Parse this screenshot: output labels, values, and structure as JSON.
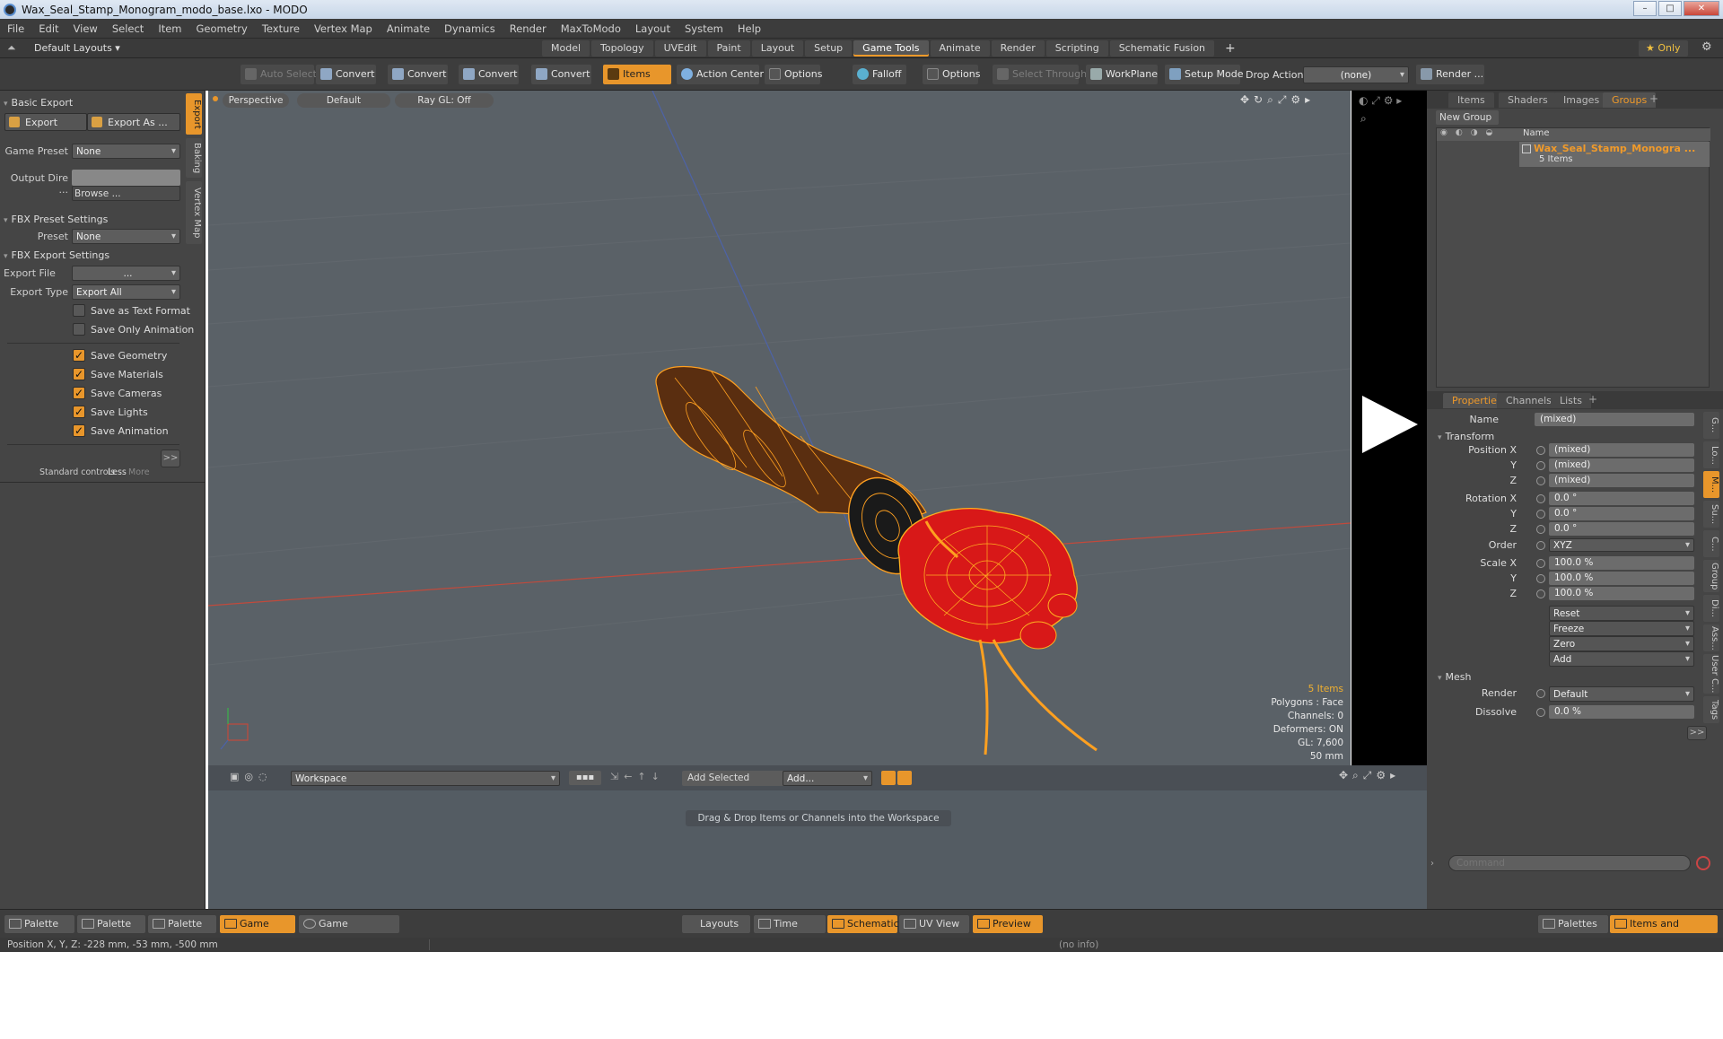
{
  "window": {
    "title": "Wax_Seal_Stamp_Monogram_modo_base.lxo - MODO",
    "min": "–",
    "max": "□",
    "close": "✕"
  },
  "menu": [
    "File",
    "Edit",
    "View",
    "Select",
    "Item",
    "Geometry",
    "Texture",
    "Vertex Map",
    "Animate",
    "Dynamics",
    "Render",
    "MaxToModo",
    "Layout",
    "System",
    "Help"
  ],
  "layout_selector": "Default Layouts ▾",
  "workspace_tabs": [
    {
      "label": "Model",
      "active": false
    },
    {
      "label": "Topology",
      "active": false
    },
    {
      "label": "UVEdit",
      "active": false
    },
    {
      "label": "Paint",
      "active": false
    },
    {
      "label": "Layout",
      "active": false
    },
    {
      "label": "Setup",
      "active": false
    },
    {
      "label": "Game Tools",
      "active": true
    },
    {
      "label": "Animate",
      "active": false
    },
    {
      "label": "Render",
      "active": false
    },
    {
      "label": "Scripting",
      "active": false
    },
    {
      "label": "Schematic Fusion",
      "active": false
    }
  ],
  "add_tab": "+",
  "only_label": "★ Only",
  "toolbar": {
    "auto_select": "Auto Select",
    "convert1": "Convert",
    "convert2": "Convert",
    "convert3": "Convert",
    "convert4": "Convert",
    "items": "Items",
    "action_center": "Action Center",
    "options1": "Options",
    "falloff": "Falloff",
    "options2": "Options",
    "select_through": "Select Through",
    "workplane": "WorkPlane",
    "setup_mode": "Setup Mode",
    "drop_action": "Drop Action",
    "drop_value": "(none)",
    "render": "Render ..."
  },
  "left": {
    "basic_export": "Basic Export",
    "export": "Export",
    "export_as": "Export As ...",
    "game_preset_label": "Game Preset",
    "game_preset_value": "None",
    "output_dir_label": "Output Dire ...",
    "output_dir_value": "",
    "browse": "Browse ...",
    "fbx_preset_settings": "FBX Preset Settings",
    "preset_label": "Preset",
    "preset_value": "None",
    "fbx_export_settings": "FBX Export Settings",
    "export_file_label": "Export File",
    "export_file_value": "...",
    "export_type_label": "Export Type",
    "export_type_value": "Export All",
    "checks": [
      {
        "label": "Save as Text Format",
        "checked": false
      },
      {
        "label": "Save Only Animation",
        "checked": false
      },
      {
        "label": "Save Geometry",
        "checked": true
      },
      {
        "label": "Save Materials",
        "checked": true
      },
      {
        "label": "Save Cameras",
        "checked": true
      },
      {
        "label": "Save Lights",
        "checked": true
      },
      {
        "label": "Save Animation",
        "checked": true
      }
    ],
    "expand": ">>",
    "standard_controls": "Standard controls",
    "less": "Less",
    "more": "More",
    "vtabs": [
      "Export",
      "Baking",
      "Vertex Map"
    ]
  },
  "viewport": {
    "perspective": "Perspective",
    "default": "Default",
    "raygl": "Ray GL: Off",
    "info": {
      "items": "5 Items",
      "polygons": "Polygons : Face",
      "channels": "Channels: 0",
      "deformers": "Deformers: ON",
      "gl": "GL: 7,600",
      "scale": "50 mm"
    }
  },
  "schematic": {
    "workspace": "Workspace",
    "add_selected": "Add Selected",
    "add": "Add...",
    "hint": "Drag & Drop Items or Channels into the Workspace"
  },
  "right": {
    "tabs": [
      {
        "label": "Items",
        "active": false
      },
      {
        "label": "Shaders",
        "active": false
      },
      {
        "label": "Images",
        "active": false
      },
      {
        "label": "Groups",
        "active": true
      }
    ],
    "new_group": "New Group",
    "name_header": "Name",
    "group_name": "Wax_Seal_Stamp_Monogra ...",
    "group_count": "5 Items",
    "prop_tabs": [
      {
        "label": "Properties",
        "active": true
      },
      {
        "label": "Channels",
        "active": false
      },
      {
        "label": "Lists",
        "active": false
      }
    ],
    "name_label": "Name",
    "name_value": "(mixed)",
    "transform": "Transform",
    "position_label": "Position X",
    "pos": [
      "(mixed)",
      "(mixed)",
      "(mixed)"
    ],
    "rotation_label": "Rotation X",
    "rot": [
      "0.0 °",
      "0.0 °",
      "0.0 °"
    ],
    "order_label": "Order",
    "order_value": "XYZ",
    "scale_label": "Scale X",
    "scale": [
      "100.0 %",
      "100.0 %",
      "100.0 %"
    ],
    "y": "Y",
    "z": "Z",
    "actions": [
      "Reset",
      "Freeze",
      "Zero",
      "Add"
    ],
    "mesh": "Mesh",
    "render_label": "Render",
    "render_value": "Default",
    "dissolve_label": "Dissolve",
    "dissolve_value": "0.0 %",
    "side_tabs": [
      "G...",
      "Lo...",
      "M...",
      "Su...",
      "C...",
      "Group",
      "Di...",
      "Ass...",
      "User C...",
      "Tags"
    ],
    "command_placeholder": "Command"
  },
  "footer": {
    "left": [
      {
        "label": "Palette",
        "active": false
      },
      {
        "label": "Palette",
        "active": false
      },
      {
        "label": "Palette",
        "active": false
      },
      {
        "label": "Game Tools",
        "active": true
      },
      {
        "label": "Game Navigation",
        "active": false
      }
    ],
    "center": [
      {
        "label": "Layouts",
        "active": false
      },
      {
        "label": "Time",
        "active": false
      },
      {
        "label": "Schematic",
        "active": true
      },
      {
        "label": "UV View",
        "active": false
      },
      {
        "label": "Preview",
        "active": true
      }
    ],
    "palettes": "Palettes",
    "items_shading": "Items and Shading"
  },
  "status": {
    "position": "Position X, Y, Z:   -228 mm, -53 mm, -500 mm",
    "info": "(no info)"
  },
  "colors": {
    "accent": "#e8962b",
    "viewport": "#5a6167",
    "panel": "#454545",
    "wax": "#d81818",
    "wire": "#ffb020"
  }
}
